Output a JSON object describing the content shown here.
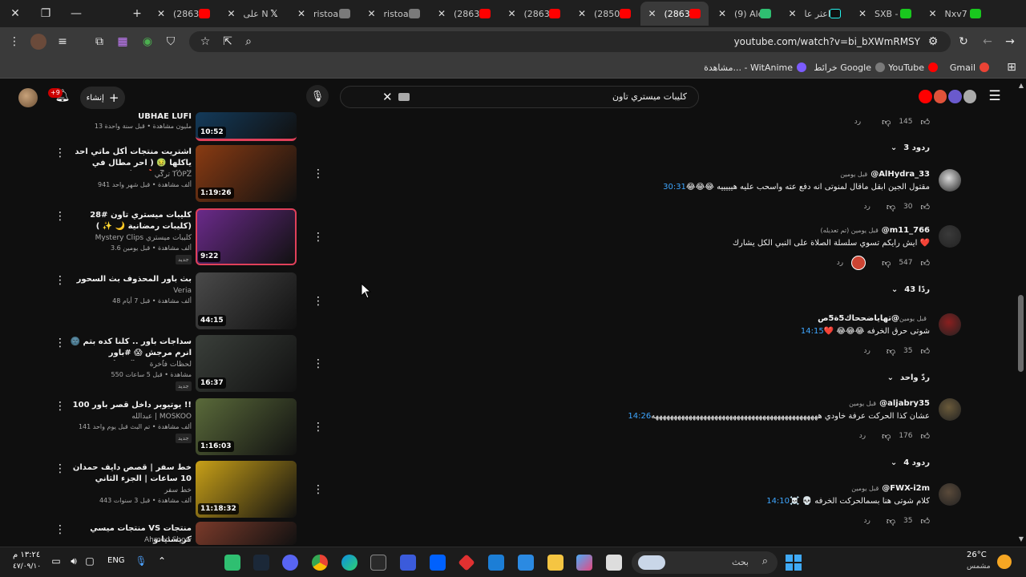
{
  "browser": {
    "tabs": [
      {
        "label": "(2863)",
        "icon": "youtube-favicon",
        "active": false
      },
      {
        "label": "على N",
        "icon": "x-favicon",
        "active": false
      },
      {
        "label": "ristoar",
        "icon": "outline-favicon",
        "active": false
      },
      {
        "label": "ristoar",
        "icon": "outline-favicon",
        "active": false
      },
      {
        "label": "(2863)",
        "icon": "youtube-favicon",
        "active": false
      },
      {
        "label": "(2863)",
        "icon": "youtube-favicon",
        "active": false
      },
      {
        "label": "(2850)",
        "icon": "youtube-favicon",
        "active": false
      },
      {
        "label": "(2863)",
        "icon": "youtube-favicon",
        "active": true
      },
      {
        "label": "(9) Ale",
        "icon": "green-favicon",
        "active": false
      },
      {
        "label": "اعثر عا",
        "icon": "tiktok-favicon",
        "active": false
      },
      {
        "label": "SXB - \\",
        "icon": "kick-favicon",
        "active": false
      },
      {
        "label": "Nxv7 S",
        "icon": "kick-favicon",
        "active": false
      }
    ],
    "url": "youtube.com/watch?v=bi_bXWmRMSY",
    "bookmarks": [
      {
        "label": "Gmail",
        "color": "#ea4335"
      },
      {
        "label": "YouTube",
        "color": "#ff0000"
      },
      {
        "label": "خرائط Google",
        "color": "#7a7a7a"
      },
      {
        "label": "مشاهدة... - WitAnime",
        "color": "#7c5cff"
      }
    ]
  },
  "youtube": {
    "search": {
      "value": "كليبات ميستري تاون"
    },
    "create_label": "إنشاء",
    "notifications_count": "+9"
  },
  "related": [
    {
      "title": "UBHAE LUFI",
      "channel": "",
      "meta": "13 مليون مشاهدة • قبل سنة واحدة",
      "duration": "10:52",
      "badge": "",
      "thumb": "#133a5a"
    },
    {
      "title": "اشتريت منتجات أكل ماتي احد ياكلها 🤢 ( احر مطال في العالم 😱 🔥 !! )",
      "channel": "تركي TOPZ",
      "meta": "941 ألف مشاهدة • قبل شهر واحد",
      "duration": "1:19:26",
      "badge": "",
      "thumb": "#8a3b12"
    },
    {
      "title": "كليبات ميستري تاون #28 (كليبات رمضانية 🌙 ✨ )",
      "channel": "Mystery Clips كليبات ميستري",
      "meta": "3.6 ألف مشاهدة • قبل يومين",
      "duration": "9:22",
      "badge": "جديد",
      "thumb": "#6a2a8a"
    },
    {
      "title": "بث باور المحذوف بث السحور",
      "channel": "Veria",
      "meta": "48 ألف مشاهدة • قبل 7 أيام",
      "duration": "44:15",
      "badge": "",
      "thumb": "#4a4a4a"
    },
    {
      "title": "سداجات باور .. كلنا كده بتم 🌚 انرم مرجش 😱 #باور #اكسبلور_explore ...",
      "channel": "لحظات فاخرة",
      "meta": "550 مشاهدة • قبل 5 ساعات",
      "duration": "16:37",
      "badge": "جديد",
      "thumb": "#3a3f3a"
    },
    {
      "title": "100 يوتيوبر داخل قصر باور !!",
      "channel": "عبدالله | MOSKOO",
      "meta": "141 ألف مشاهدة • تم البث قبل يوم واحد",
      "duration": "1:16:03",
      "badge": "جديد",
      "thumb": "#5a6a3a"
    },
    {
      "title": "خط سفر | قصص دايف حمدان 10 ساعات | الجزء الثاني",
      "channel": "خط سفر",
      "meta": "443 ألف مشاهدة • قبل 3 سنوات",
      "duration": "11:18:32",
      "badge": "",
      "thumb": "#c8a018"
    },
    {
      "title": "منتجات ميسي VS منتجات كريستيانو",
      "channel": "Ahmed Show",
      "meta": "",
      "duration": "",
      "badge": "",
      "thumb": "#7a3a2a"
    }
  ],
  "comments": {
    "top_likes": "145",
    "top_reply_label": "رد",
    "top_replies": "3 ردود",
    "items": [
      {
        "author": "@AlHydra_33",
        "time": "قبل يومين",
        "timestamp": "30:31",
        "text": "مقتول الجين ابقل ماقال لمنوتى انه دفع عته واسحب  عليه هيييييه 😂😂😂",
        "likes": "30",
        "reply": "رد",
        "replies": "",
        "avatar": "#d9d9d9"
      },
      {
        "author": "@m11_766",
        "time": "قبل يومين (تم تعديله)",
        "timestamp": "",
        "text": "ايش رايكم تسوي سلسلة الصلاة على النبي الكل يشارك ❤️",
        "likes": "547",
        "reply": "رد",
        "replies": "43 ردًا",
        "avatar": "#3a3a3a"
      },
      {
        "author": "@تهاياضححاك5ة5ص",
        "time": "قبل يومين",
        "timestamp": "14:15",
        "text": "شوتى حرق الخرفه 😂😂😂 ❤️",
        "likes": "35",
        "reply": "رد",
        "replies": "ردّ واحد",
        "avatar": "#8a1f1f"
      },
      {
        "author": "@aljabry35",
        "time": "قبل يومين",
        "timestamp": "14:26",
        "text": "عشان كذا الحركت عرفة خاودي هههههههههههههههههههههههههههههههههههههههههههههه",
        "likes": "176",
        "reply": "رد",
        "replies": "4 ردود",
        "avatar": "#6a5a3a"
      },
      {
        "author": "@FWX-i2m",
        "time": "قبل يومين",
        "timestamp": "14:10",
        "text": "كلام شوتى هنا بسمالحركت الخرفه 💀 ☠️",
        "likes": "35",
        "reply": "رد",
        "replies": "",
        "avatar": "#5a4a3a"
      }
    ]
  },
  "taskbar": {
    "search_placeholder": "بحث",
    "weather_temp": "26°C",
    "weather_cond": "مشمس",
    "lang": "ENG",
    "time": "١٣:٢٤ م",
    "date": "٤٧/٠٩/١٠"
  }
}
